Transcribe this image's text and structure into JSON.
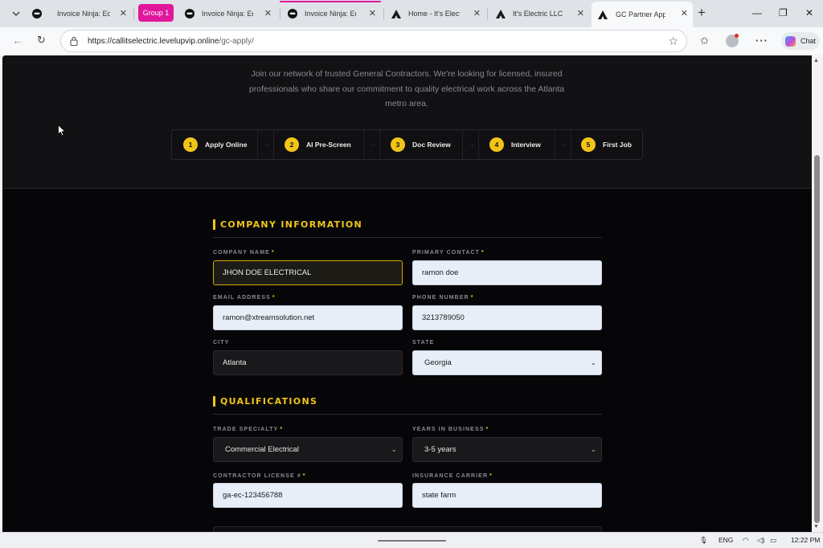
{
  "browser": {
    "tabs": [
      {
        "title": "Invoice Ninja: Ed",
        "favicon": "invoice-ninja-icon"
      },
      {
        "title": "Invoice Ninja: Ed",
        "favicon": "invoice-ninja-icon"
      },
      {
        "title": "Invoice Ninja: Ed",
        "favicon": "invoice-ninja-icon"
      },
      {
        "title": "Home - It's Electr",
        "favicon": "its-electric-icon"
      },
      {
        "title": "It's Electric LLC -",
        "favicon": "its-electric-icon"
      },
      {
        "title": "GC Partner Appl",
        "favicon": "its-electric-icon"
      }
    ],
    "group_label": "Group 1",
    "group_color": "#e0179b",
    "url_host": "https://callitselectric.levelupvip.online",
    "url_path": "/gc-apply/",
    "chat_label": "Chat"
  },
  "hero": {
    "intro": "Join our network of trusted General Contractors. We're looking for licensed, insured professionals who share our commitment to quality electrical work across the Atlanta metro area.",
    "steps": [
      {
        "num": "1",
        "label": "Apply Online"
      },
      {
        "num": "2",
        "label": "AI Pre-Screen"
      },
      {
        "num": "3",
        "label": "Doc Review"
      },
      {
        "num": "4",
        "label": "Interview"
      },
      {
        "num": "5",
        "label": "First Job"
      }
    ],
    "accent": "#f2c418"
  },
  "sections": {
    "company": {
      "title": "COMPANY INFORMATION",
      "company_name": {
        "label": "COMPANY NAME",
        "value": "JHON DOE ELECTRICAL"
      },
      "primary_contact": {
        "label": "PRIMARY CONTACT",
        "value": "ramon doe"
      },
      "email": {
        "label": "EMAIL ADDRESS",
        "value": "ramon@xtreamsolution.net"
      },
      "phone": {
        "label": "PHONE NUMBER",
        "value": "3213789050"
      },
      "city": {
        "label": "CITY",
        "value": "Atlanta"
      },
      "state": {
        "label": "STATE",
        "value": "Georgia"
      }
    },
    "qualifications": {
      "title": "QUALIFICATIONS",
      "trade": {
        "label": "TRADE SPECIALTY",
        "value": "Commercial Electrical"
      },
      "years": {
        "label": "YEARS IN BUSINESS",
        "value": "3-5 years"
      },
      "license": {
        "label": "CONTRACTOR LICENSE #",
        "value": "ga-ec-123456788"
      },
      "insurance": {
        "label": "INSURANCE CARRIER",
        "value": "state farm"
      }
    },
    "required_mark": "*"
  },
  "taskbar": {
    "language": "ENG",
    "time": "12:22 PM"
  }
}
